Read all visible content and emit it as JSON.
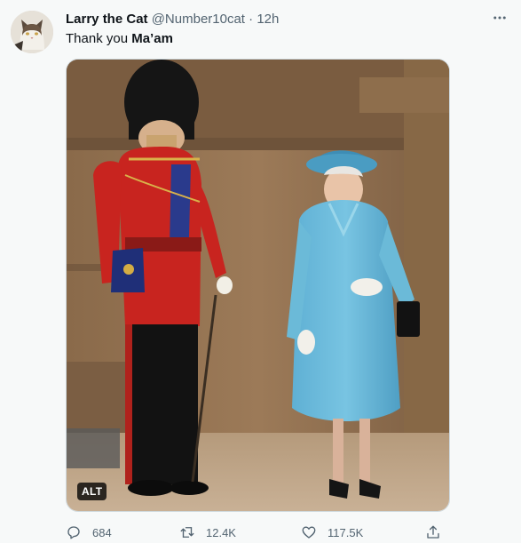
{
  "tweet": {
    "author": {
      "display_name": "Larry the Cat",
      "handle": "@Number10cat",
      "separator": "·",
      "time": "12h",
      "avatar_icon": "cat-avatar"
    },
    "text_prefix": "Thank you ",
    "text_bold": "Ma’am",
    "media": {
      "alt_badge": "ALT"
    },
    "actions": {
      "replies": "684",
      "retweets": "12.4K",
      "likes": "117.5K"
    },
    "icons": {
      "more": "more-dots-icon",
      "reply": "reply-icon",
      "retweet": "retweet-icon",
      "like": "heart-icon",
      "share": "share-icon"
    },
    "colors": {
      "background": "#f7f9f9",
      "secondary_text": "#536471",
      "primary_text": "#0f1419"
    }
  }
}
